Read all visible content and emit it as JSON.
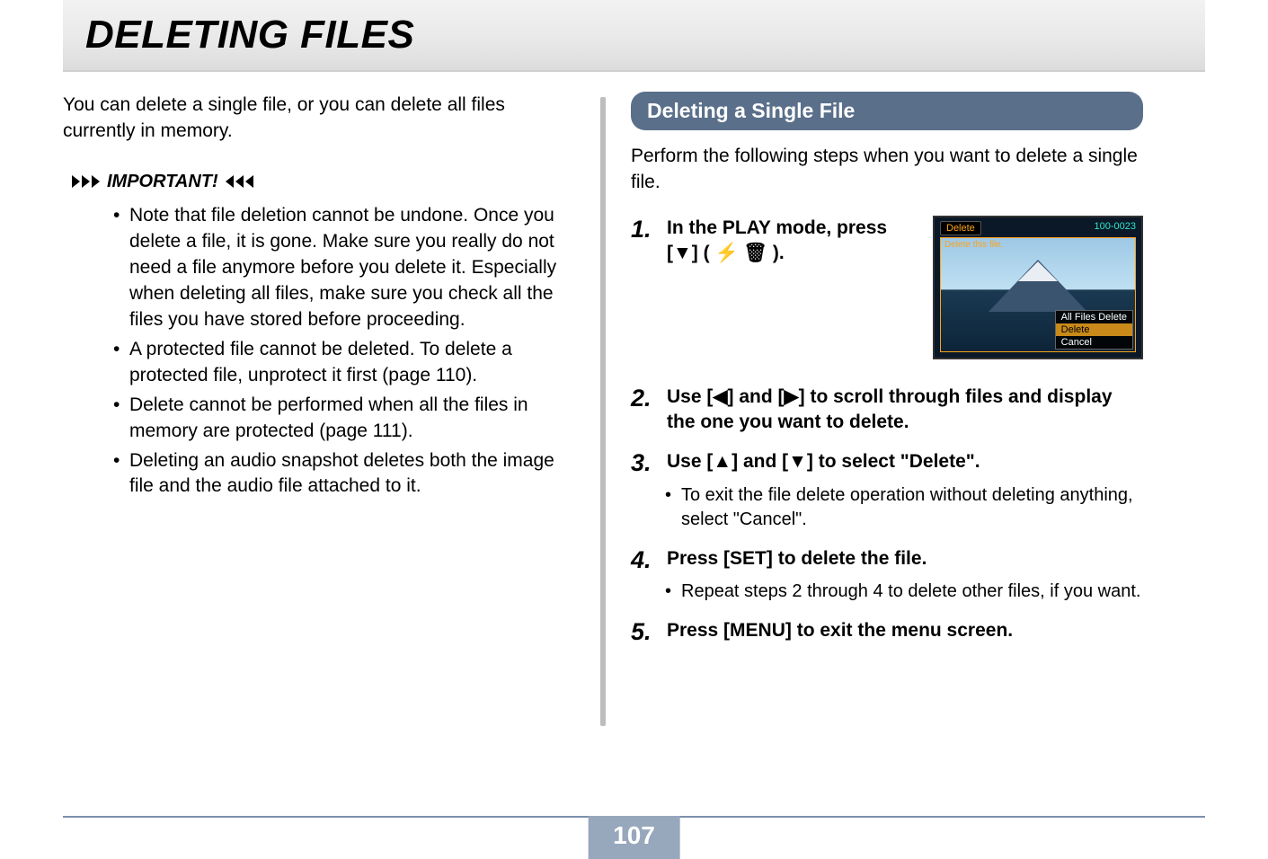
{
  "page": {
    "title": "DELETING FILES",
    "number": "107"
  },
  "left": {
    "intro": "You can delete a single file, or you can delete all files currently in memory.",
    "important_label": "IMPORTANT!",
    "notes": [
      "Note that file deletion cannot be undone. Once you delete a file, it is gone. Make sure you really do not need a file anymore before you delete it. Especially when deleting all files, make sure you check all the files you have stored before proceeding.",
      "A protected file cannot be deleted. To delete a protected file, unprotect it first (page 110).",
      "Delete cannot be performed when all the files in memory are protected (page 111).",
      "Deleting an audio snapshot deletes both the image file and the audio file attached to it."
    ]
  },
  "right": {
    "section_title": "Deleting a Single File",
    "section_intro": "Perform the following steps when you want to delete a single file.",
    "steps": [
      {
        "num": "1.",
        "text_pre": "In the PLAY mode, press [",
        "arrow": "▼",
        "text_post": "] ( ⚡ 🗑 )."
      },
      {
        "num": "2.",
        "text": "Use [◀] and [▶] to scroll through files and display the one you want to delete."
      },
      {
        "num": "3.",
        "text": "Use [▲] and [▼] to select \"Delete\".",
        "sub": "To exit the file delete operation without deleting anything, select \"Cancel\"."
      },
      {
        "num": "4.",
        "text": "Press [SET] to delete the file.",
        "sub": "Repeat steps 2 through 4 to delete other files, if you want."
      },
      {
        "num": "5.",
        "text": "Press [MENU] to exit the menu screen."
      }
    ],
    "lcd": {
      "top_label": "Delete",
      "file_no": "100-0023",
      "subtitle": "Delete this file.",
      "menu": {
        "opt1": "All Files Delete",
        "opt2": "Delete",
        "opt3": "Cancel"
      }
    }
  }
}
